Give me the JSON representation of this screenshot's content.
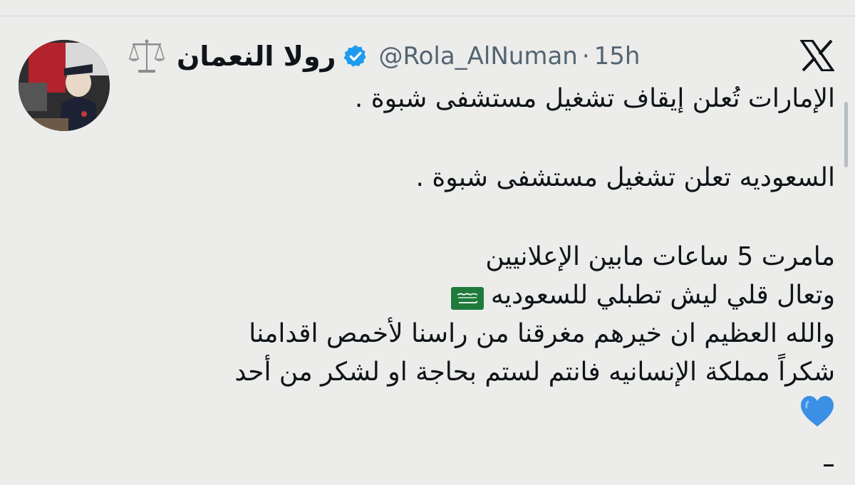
{
  "author": {
    "display_name": "رولا النعمان",
    "handle": "@Rola_AlNuman",
    "separator": "·",
    "time": "15h",
    "name_icon": "scales-of-justice-icon",
    "verified_icon": "verified-badge-icon"
  },
  "platform": {
    "logo_icon": "x-logo-icon"
  },
  "tweet": {
    "line1": "الإمارات تُعلن إيقاف تشغيل مستشفى شبوة .",
    "line2": "السعوديه تعلن تشغيل مستشفى شبوة .",
    "line3": "مامرت 5 ساعات مابين الإعلانيين",
    "line4": "وتعال قلي ليش تطبلي للسعوديه",
    "line5": "والله العظيم ان خيرهم مغرقنا من راسنا لأخمص اقدامنا",
    "line6": "شكراً مملكة الإنسانيه فانتم لستم بحاجة او لشكر من أحد",
    "flag_emoji": "saudi-flag-icon",
    "heart_emoji": "blue-heart-icon"
  },
  "colors": {
    "background": "#ececeb",
    "text": "#0f1419",
    "secondary_text": "#536471",
    "verified": "#1d9bf0",
    "heart": "#3b8fe4",
    "flag": "#1f7a3c"
  }
}
